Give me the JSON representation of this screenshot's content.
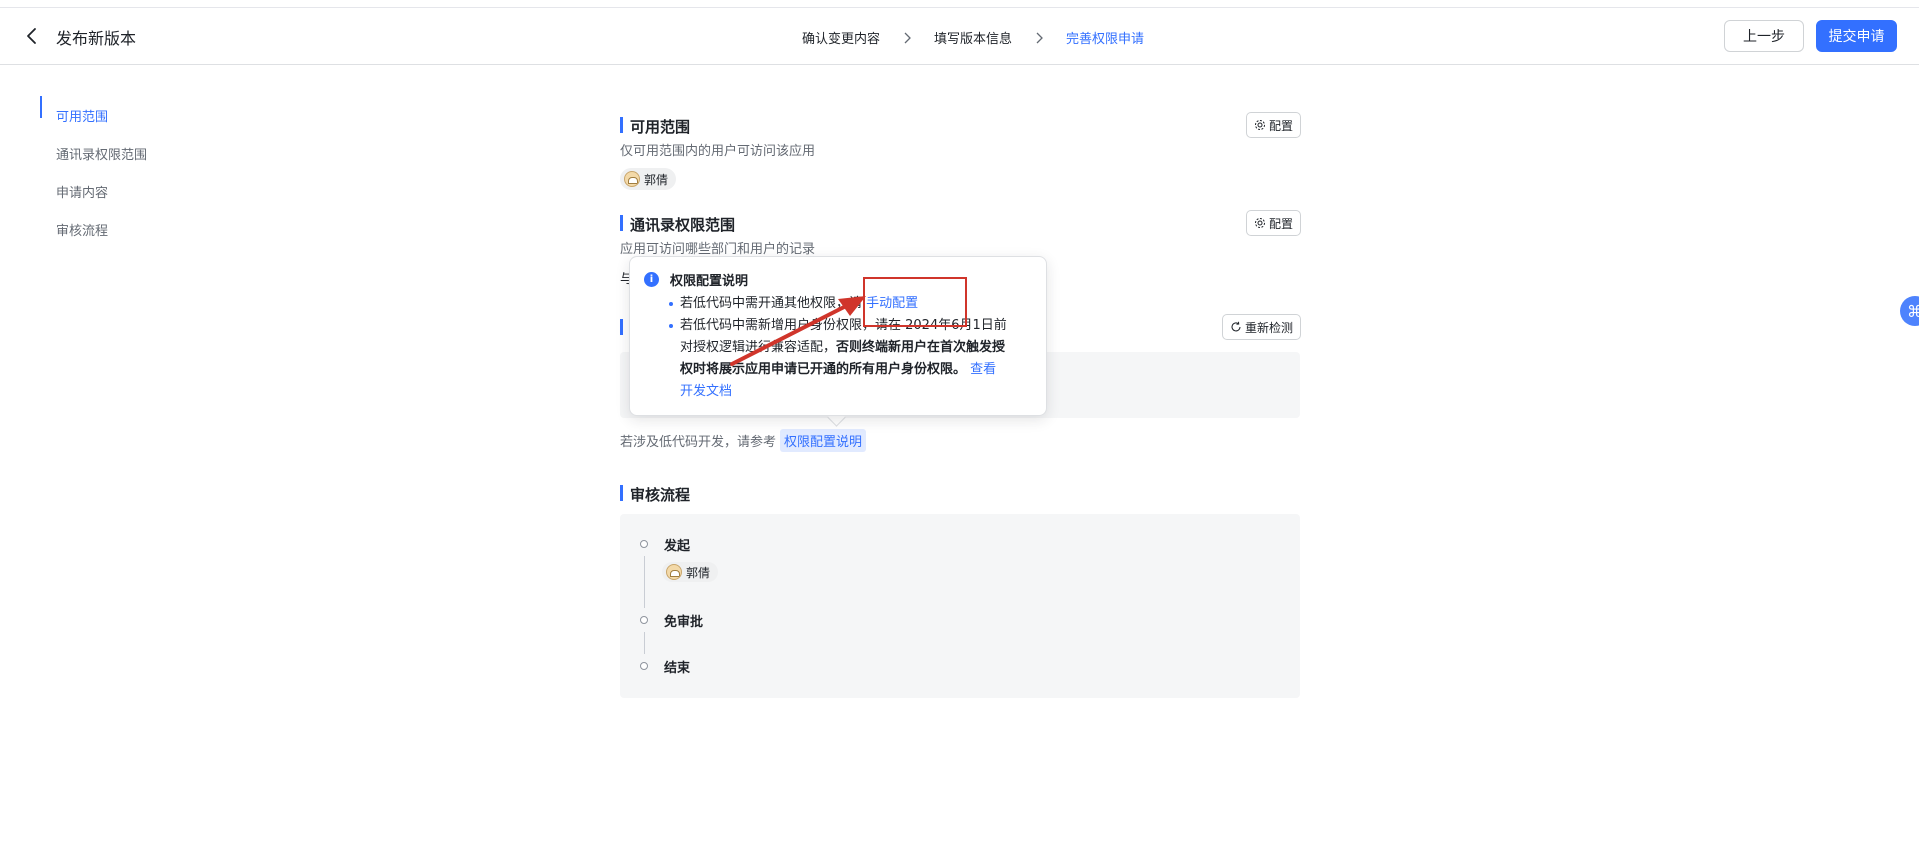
{
  "header": {
    "title": "发布新版本",
    "steps": [
      "确认变更内容",
      "填写版本信息",
      "完善权限申请"
    ],
    "prev_label": "上一步",
    "submit_label": "提交申请"
  },
  "leftnav": {
    "items": [
      "可用范围",
      "通讯录权限范围",
      "申请内容",
      "审核流程"
    ]
  },
  "available_range": {
    "title": "可用范围",
    "desc": "仅可用范围内的用户可访问该应用",
    "config_label": "配置",
    "user": "郭倩"
  },
  "contacts_range": {
    "title": "通讯录权限范围",
    "desc": "应用可访问哪些部门和用户的记录",
    "config_label": "配置",
    "partial_text": "与"
  },
  "apply_content": {
    "recheck_label": "重新检测",
    "ref_text": "若涉及低代码开发，请参考",
    "ref_link": "权限配置说明"
  },
  "review_flow": {
    "title": "审核流程",
    "steps": [
      {
        "label": "发起",
        "user": "郭倩"
      },
      {
        "label": "免审批"
      },
      {
        "label": "结束"
      }
    ]
  },
  "popover": {
    "title": "权限配置说明",
    "line1_text": "若低代码中需开通其他权限，请",
    "line1_link": "手动配置",
    "line2_text": "若低代码中需新增用户身份权限，请在 2024年6月1日前",
    "line3_text": "对授权逻辑进行兼容适配，",
    "line3_bold": "否则终端新用户在首次触发授",
    "line4_bold": "权时将展示应用申请已开通的所有用户身份权限。",
    "line4_link": "查看",
    "line5_link": "开发文档"
  },
  "colors": {
    "accent": "#3370ff",
    "annotation": "#d0352b"
  }
}
